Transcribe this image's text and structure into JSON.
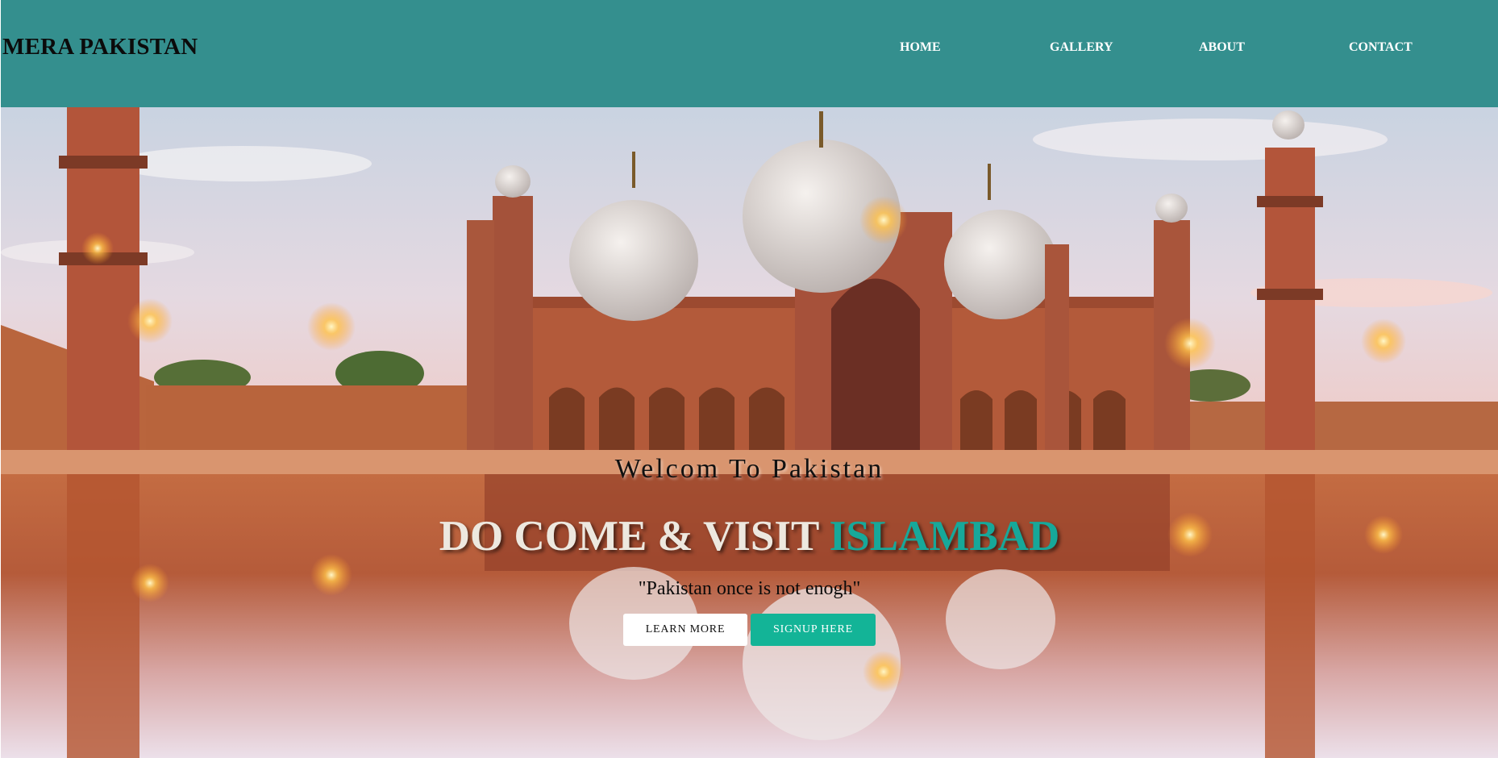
{
  "navbar": {
    "brand": "MERA PAKISTAN",
    "links": [
      {
        "label": "HOME"
      },
      {
        "label": "GALLERY"
      },
      {
        "label": "ABOUT"
      },
      {
        "label": "CONTACT"
      }
    ]
  },
  "hero": {
    "welcome": "Welcom To Pakistan",
    "headline_main": "DO COME & VISIT ",
    "headline_accent": "ISLAMBAD",
    "quote": "\"Pakistan once is not enogh\"",
    "primary_button": "LEARN MORE",
    "secondary_button": "SIGNUP HERE"
  },
  "colors": {
    "navbar": "#348f8e",
    "accent_text": "#17a89a",
    "signup_button": "#13b497"
  },
  "icons": []
}
